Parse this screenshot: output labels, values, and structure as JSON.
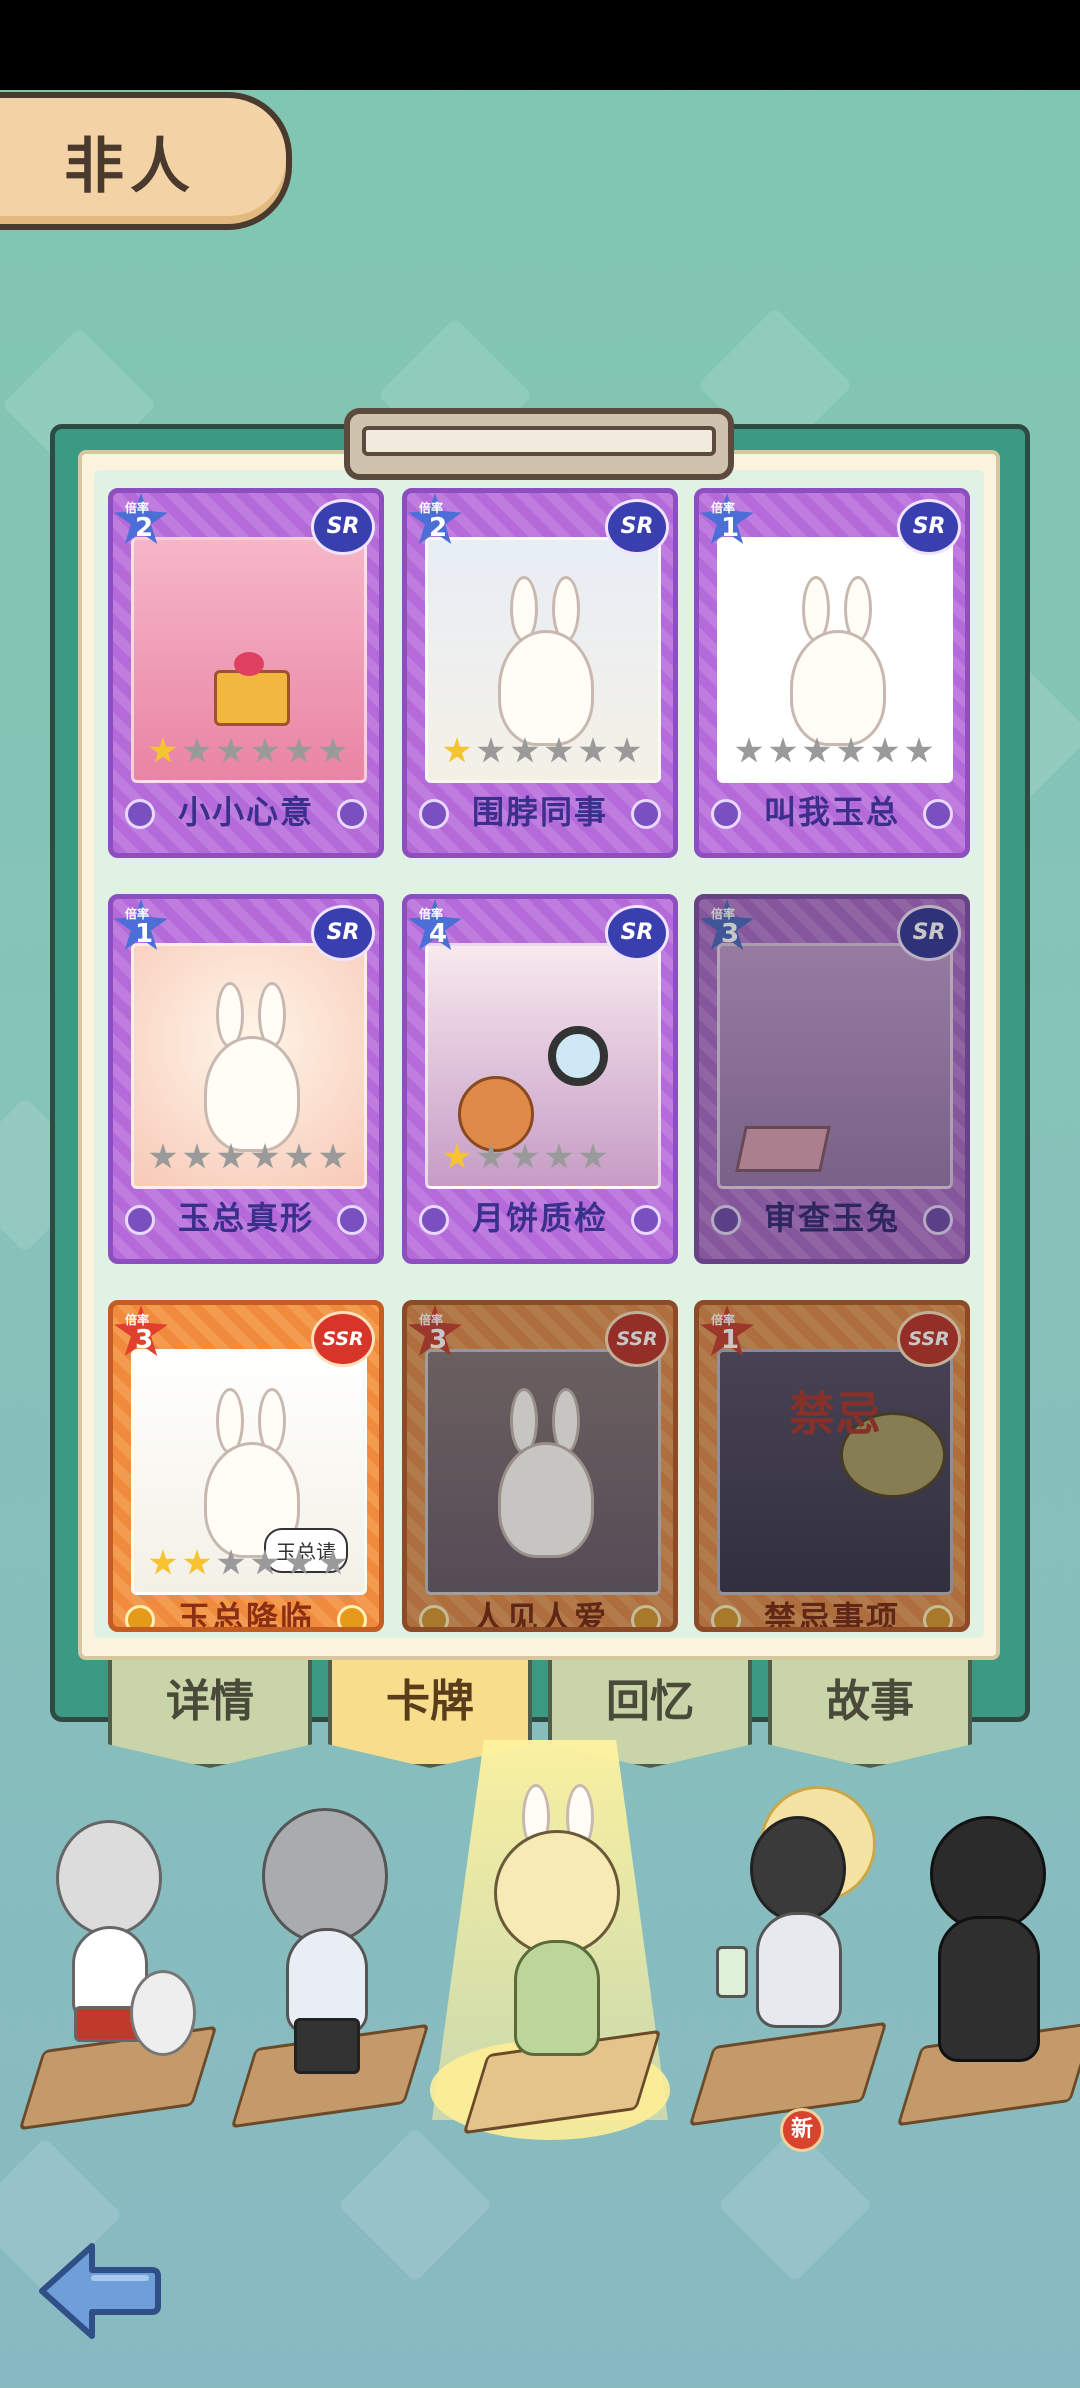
{
  "header": {
    "category": "非人"
  },
  "cards": [
    {
      "rank_label": "倍率",
      "rank": "2",
      "rarity": "SR",
      "name": "小小心意",
      "stars_on": 1,
      "stars_total": 6,
      "owned": true
    },
    {
      "rank_label": "倍率",
      "rank": "2",
      "rarity": "SR",
      "name": "围脖同事",
      "stars_on": 1,
      "stars_total": 6,
      "owned": true
    },
    {
      "rank_label": "倍率",
      "rank": "1",
      "rarity": "SR",
      "name": "叫我玉总",
      "stars_on": 0,
      "stars_total": 6,
      "owned": true
    },
    {
      "rank_label": "倍率",
      "rank": "1",
      "rarity": "SR",
      "name": "玉总真形",
      "stars_on": 0,
      "stars_total": 6,
      "owned": true
    },
    {
      "rank_label": "倍率",
      "rank": "4",
      "rarity": "SR",
      "name": "月饼质检",
      "stars_on": 1,
      "stars_total": 5,
      "owned": true
    },
    {
      "rank_label": "倍率",
      "rank": "3",
      "rarity": "SR",
      "name": "审查玉兔",
      "stars_on": 0,
      "stars_total": 0,
      "owned": false
    },
    {
      "rank_label": "倍率",
      "rank": "3",
      "rarity": "SSR",
      "name": "玉总降临",
      "stars_on": 2,
      "stars_total": 6,
      "owned": true,
      "bubble": "玉总请"
    },
    {
      "rank_label": "倍率",
      "rank": "3",
      "rarity": "SSR",
      "name": "人见人爱",
      "stars_on": 0,
      "stars_total": 0,
      "owned": false
    },
    {
      "rank_label": "倍率",
      "rank": "1",
      "rarity": "SSR",
      "name": "禁忌事项",
      "stars_on": 0,
      "stars_total": 0,
      "owned": false,
      "art_text": "禁忌"
    }
  ],
  "tabs": [
    "详情",
    "卡牌",
    "回忆",
    "故事"
  ],
  "active_tab": "卡牌",
  "characters": [
    {
      "id": "fox-tail",
      "new": false
    },
    {
      "id": "deer-antlers",
      "new": false
    },
    {
      "id": "bunny-girl",
      "new": false,
      "selected": true
    },
    {
      "id": "halo-man",
      "new": true
    },
    {
      "id": "shadow-suit",
      "new": false
    }
  ],
  "new_badge": "新",
  "colors": {
    "sr": "#b46ad8",
    "ssr": "#f08a3c",
    "board": "#3c9a83",
    "accent": "#f7dd8c"
  },
  "icons": {
    "back": "back-arrow-icon",
    "star": "star-icon"
  }
}
